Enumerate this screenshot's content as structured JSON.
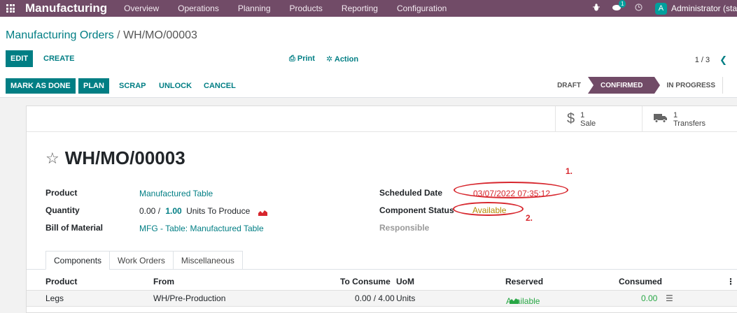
{
  "navbar": {
    "brand": "Manufacturing",
    "menu": [
      "Overview",
      "Operations",
      "Planning",
      "Products",
      "Reporting",
      "Configuration"
    ],
    "messages_count": "1",
    "user_initial": "A",
    "user_name": "Administrator (sta"
  },
  "control": {
    "breadcrumb_parent": "Manufacturing Orders",
    "breadcrumb_sep": " / ",
    "breadcrumb_current": "WH/MO/00003",
    "edit_label": "EDIT",
    "create_label": "CREATE",
    "print_label": "Print",
    "action_label": "Action",
    "pager": "1 / 3",
    "actions": [
      "MARK AS DONE",
      "PLAN",
      "SCRAP",
      "UNLOCK",
      "CANCEL"
    ],
    "stages": [
      "DRAFT",
      "CONFIRMED",
      "IN PROGRESS"
    ],
    "active_stage": "CONFIRMED"
  },
  "smart_buttons": [
    {
      "icon": "dollar-icon",
      "count": "1",
      "label": "Sale"
    },
    {
      "icon": "truck-icon",
      "count": "1",
      "label": "Transfers"
    }
  ],
  "form": {
    "title": "WH/MO/00003",
    "product_label": "Product",
    "product_value": "Manufactured Table",
    "quantity_label": "Quantity",
    "quantity_produced": "0.00 /",
    "quantity_target": "1.00",
    "quantity_unit": "Units To Produce",
    "bom_label": "Bill of Material",
    "bom_value": "MFG - Table: Manufactured Table",
    "scheduled_label": "Scheduled Date",
    "scheduled_value": "03/07/2022 07:35:12",
    "component_status_label": "Component Status",
    "component_status_value": "Available",
    "responsible_label": "Responsible"
  },
  "annotations": [
    "1.",
    "2."
  ],
  "tabs": [
    "Components",
    "Work Orders",
    "Miscellaneous"
  ],
  "table": {
    "headers": [
      "Product",
      "From",
      "To Consume",
      "UoM",
      "Reserved",
      "Consumed"
    ],
    "rows": [
      {
        "product": "Legs",
        "from": "WH/Pre-Production",
        "to_consume": "0.00 / 4.00",
        "uom": "Units",
        "reserved": "Available",
        "consumed": "0.00"
      }
    ]
  },
  "colors": {
    "brand": "#714b67",
    "accent": "#017e84",
    "annotation": "#d7262d"
  }
}
